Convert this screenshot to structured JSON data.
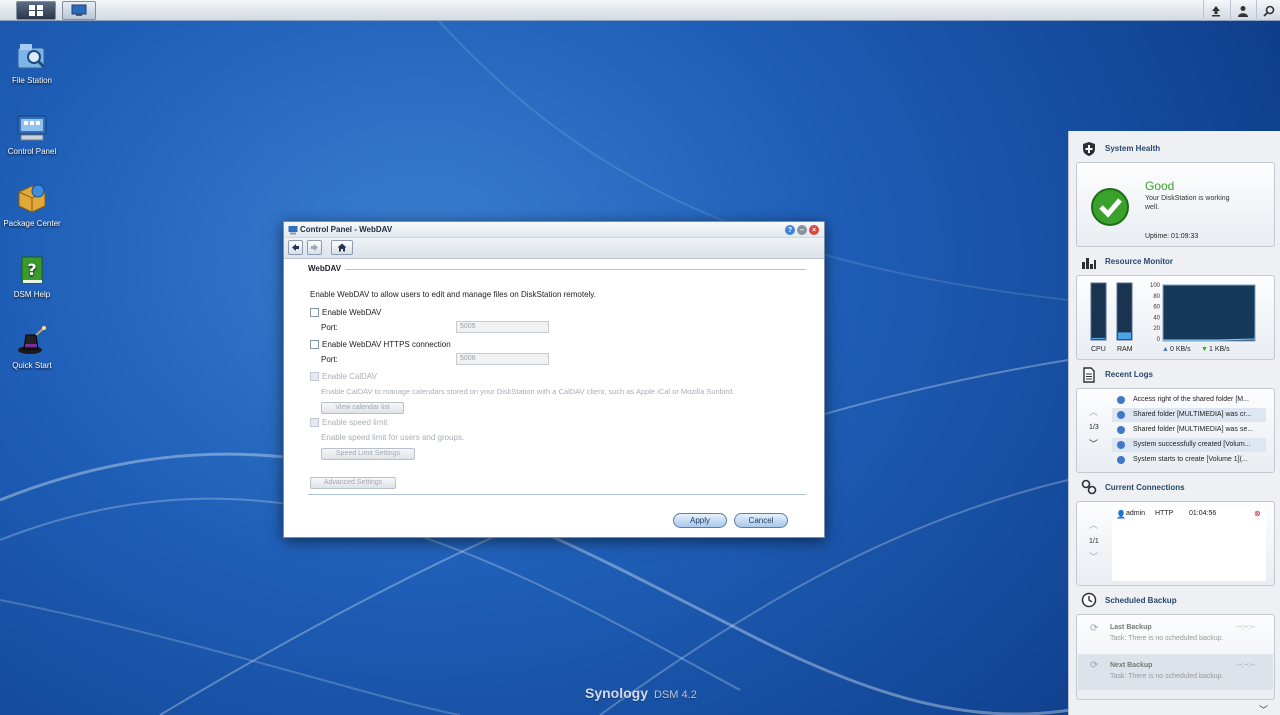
{
  "desktop": {
    "icons": [
      {
        "label": "File Station"
      },
      {
        "label": "Control Panel"
      },
      {
        "label": "Package Center"
      },
      {
        "label": "DSM Help"
      },
      {
        "label": "Quick Start"
      }
    ],
    "logo": {
      "brand": "Synology",
      "product": "DSM 4.2"
    }
  },
  "window": {
    "title": "Control Panel - WebDAV",
    "section": "WebDAV",
    "description": "Enable WebDAV to allow users to edit and manage files on DiskStation remotely.",
    "enable_webdav": {
      "label": "Enable WebDAV",
      "checked": false
    },
    "port_label_1": "Port:",
    "port_webdav": {
      "placeholder": "5005"
    },
    "enable_https": {
      "label": "Enable WebDAV HTTPS connection",
      "checked": false
    },
    "port_label_2": "Port:",
    "port_https": {
      "placeholder": "5006"
    },
    "enable_caldav": {
      "label": "Enable CalDAV",
      "checked": false
    },
    "caldav_desc": "Enable CalDAV to manage calendars stored on your DiskStation with a CalDAV client, such as Apple iCal or Mozilla Sunbird.",
    "view_calendar_btn": "View calendar list",
    "enable_speed": {
      "label": "Enable speed limit",
      "checked": false
    },
    "speed_desc": "Enable speed limit for users and groups.",
    "speed_settings_btn": "Speed Limit Settings",
    "advanced_btn": "Advanced Settings",
    "apply": "Apply",
    "cancel": "Cancel"
  },
  "widgets": {
    "system_health": {
      "title": "System Health",
      "status": "Good",
      "message": "Your DiskStation is working well.",
      "uptime": "Uptime: 01:09:33",
      "status_color": "#3aa22c"
    },
    "resource_monitor": {
      "title": "Resource Monitor",
      "cpu_label": "CPU",
      "ram_label": "RAM",
      "cpu_percent": 2,
      "ram_percent": 12,
      "y_ticks": [
        "100",
        "80",
        "60",
        "40",
        "20",
        "0"
      ],
      "upload": "0 KB/s",
      "download": "1 KB/s"
    },
    "recent_logs": {
      "title": "Recent Logs",
      "page": "1/3",
      "items": [
        "Access right of the shared folder [M...",
        "Shared folder [MULTIMEDIA] was cr...",
        "Shared folder [MULTIMEDIA] was se...",
        "System successfully created [Volum...",
        "System starts to create [Volume 1](..."
      ]
    },
    "current_connections": {
      "title": "Current Connections",
      "page": "1/1",
      "user": "admin",
      "protocol": "HTTP",
      "time": "01:04:56"
    },
    "scheduled_backup": {
      "title": "Scheduled Backup",
      "last_label": "Last Backup",
      "last_time": "--:--:--",
      "last_task": "Task: There is no scheduled backup.",
      "next_label": "Next Backup",
      "next_time": "--:--:--",
      "next_task": "Task: There is no scheduled backup."
    }
  }
}
